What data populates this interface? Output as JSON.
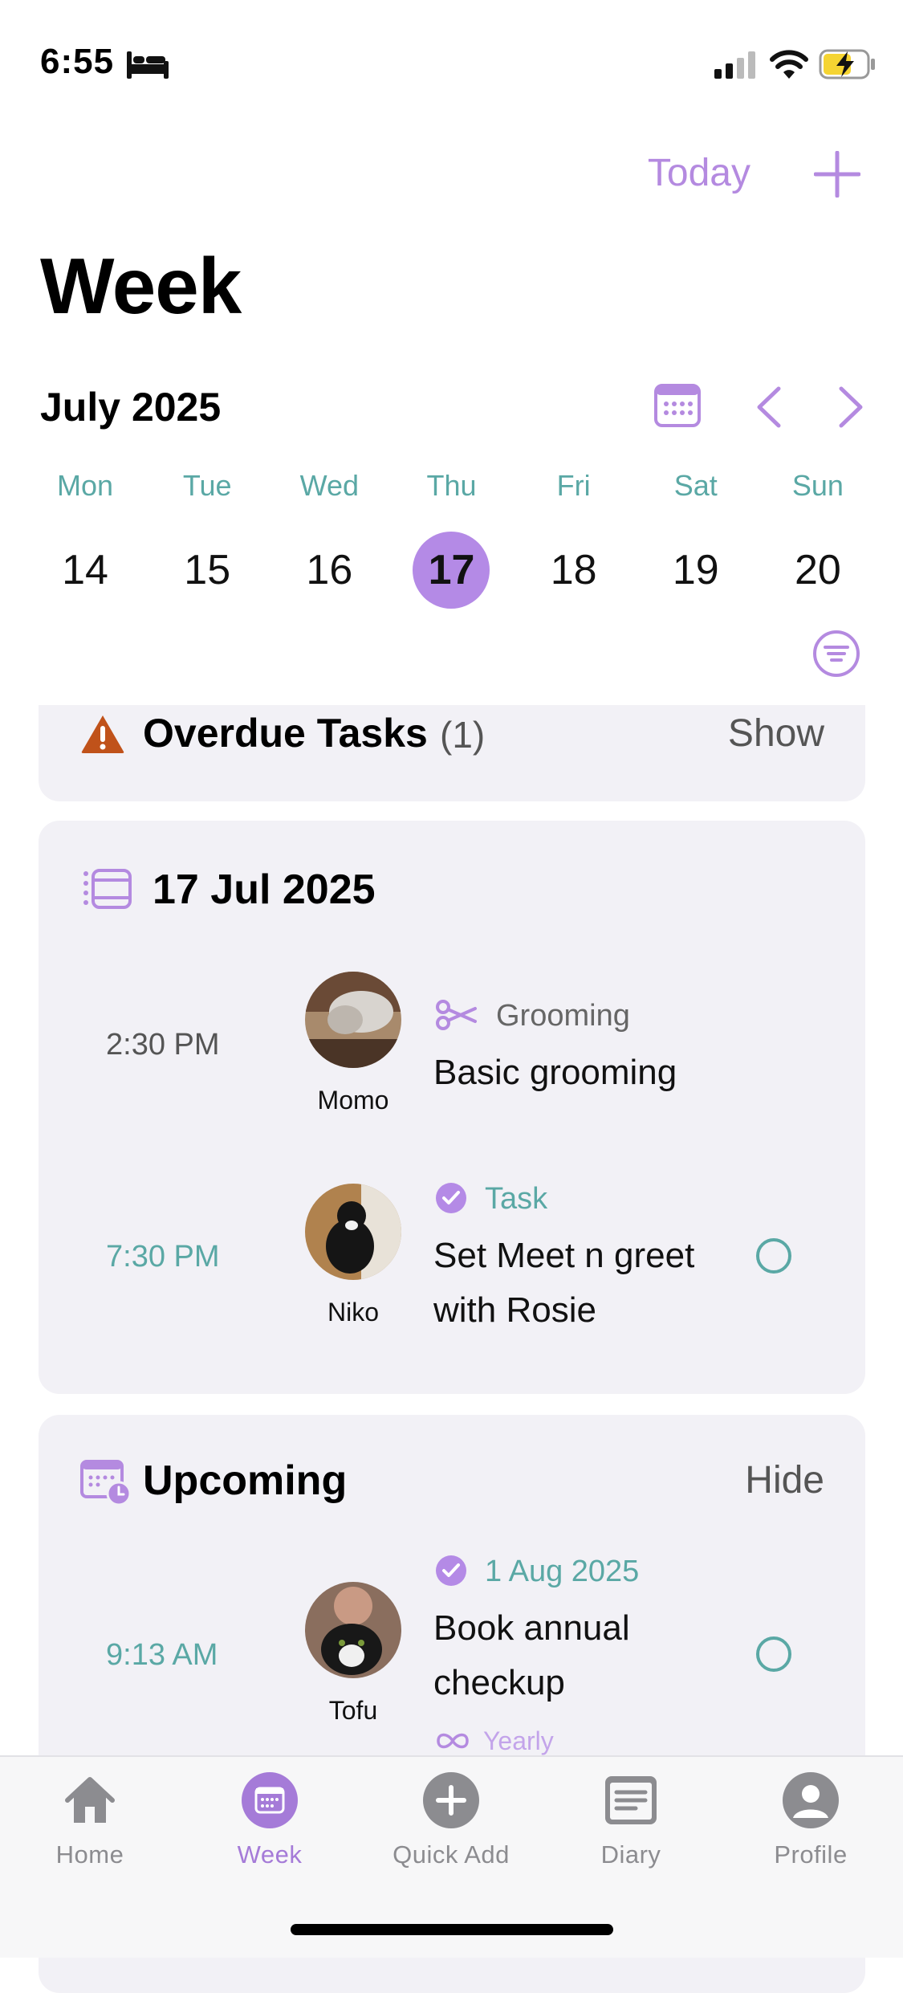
{
  "status_bar": {
    "time": "6:55"
  },
  "header": {
    "today_label": "Today",
    "title": "Week"
  },
  "calendar": {
    "month": "July 2025",
    "days": [
      {
        "name": "Mon",
        "num": "14"
      },
      {
        "name": "Tue",
        "num": "15"
      },
      {
        "name": "Wed",
        "num": "16"
      },
      {
        "name": "Thu",
        "num": "17"
      },
      {
        "name": "Fri",
        "num": "18"
      },
      {
        "name": "Sat",
        "num": "19"
      },
      {
        "name": "Sun",
        "num": "20"
      }
    ],
    "selected_day": "17"
  },
  "overdue": {
    "title": "Overdue Tasks",
    "count": "(1)",
    "action": "Show"
  },
  "day_section": {
    "date": "17 Jul 2025",
    "items": [
      {
        "time": "2:30 PM",
        "pet": "Momo",
        "category": "Grooming",
        "title": "Basic grooming"
      },
      {
        "time": "7:30 PM",
        "pet": "Niko",
        "category": "Task",
        "title_line1": "Set Meet n greet",
        "title_line2": "with Rosie"
      }
    ]
  },
  "upcoming": {
    "title": "Upcoming",
    "action": "Hide",
    "items": [
      {
        "time": "9:13 AM",
        "pet": "Tofu",
        "date": "1 Aug 2025",
        "title_line1": "Book annual",
        "title_line2": "checkup",
        "repeat": "Yearly"
      }
    ]
  },
  "tabs": [
    {
      "label": "Home"
    },
    {
      "label": "Week"
    },
    {
      "label": "Quick Add"
    },
    {
      "label": "Diary"
    },
    {
      "label": "Profile"
    }
  ],
  "colors": {
    "accent": "#b48ae6",
    "teal": "#5aa8a5",
    "card_bg": "#f2f1f6",
    "warning": "#c0521a"
  }
}
